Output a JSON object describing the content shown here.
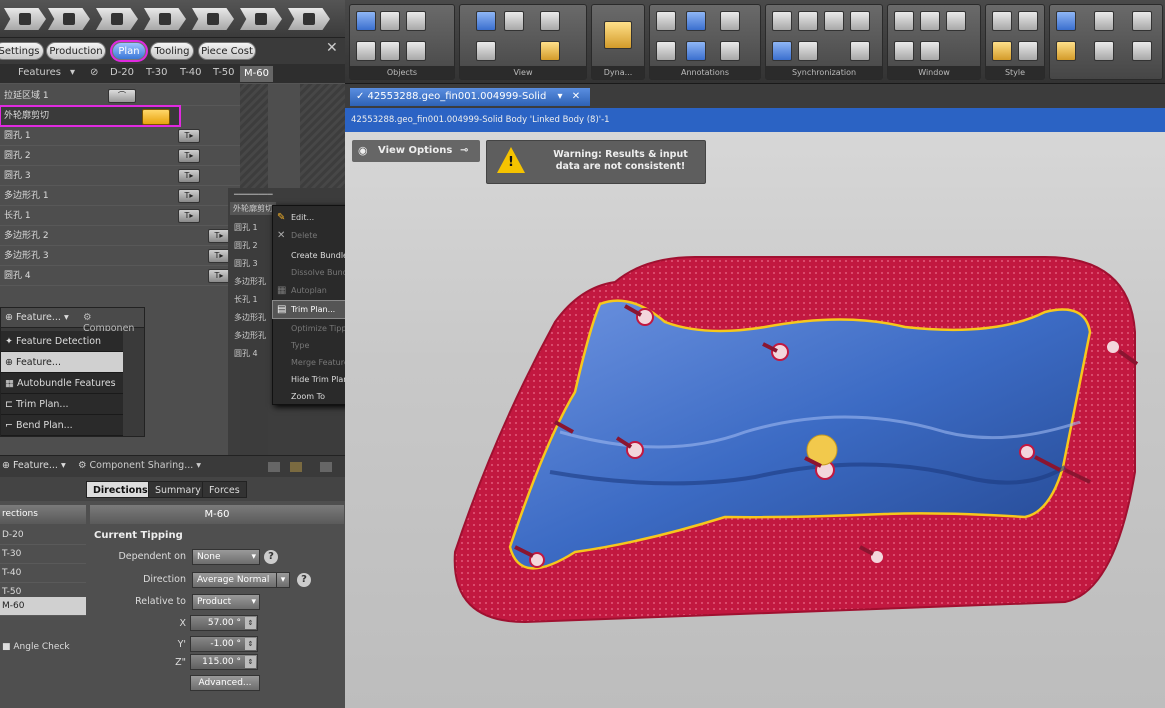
{
  "plan_tabs": [
    "Settings",
    "Production",
    "Plan",
    "Tooling",
    "Piece Cost"
  ],
  "features_header": {
    "label": "Features",
    "columns": [
      "D-20",
      "T-30",
      "T-40",
      "T-50",
      "M-60"
    ]
  },
  "feature_rows": [
    "拉延区域 1",
    "外轮廓剪切",
    "圆孔 1",
    "圆孔 2",
    "圆孔 3",
    "多边形孔 1",
    "长孔 1",
    "多边形孔 2",
    "多边形孔 3",
    "圆孔 4"
  ],
  "ghost_rows": [
    "外轮廓剪切",
    "圆孔 1",
    "圆孔 2",
    "圆孔 3",
    "多边形孔",
    "长孔 1",
    "多边形孔",
    "多边形孔",
    "圆孔 4"
  ],
  "context_menu": {
    "items": [
      {
        "label": "Edit...",
        "disabled": false,
        "submenu": false
      },
      {
        "label": "Delete",
        "disabled": true,
        "submenu": false
      },
      {
        "label": "Create Bundle",
        "disabled": false,
        "submenu": false
      },
      {
        "label": "Dissolve Bundle",
        "disabled": true,
        "submenu": false
      },
      {
        "label": "Autoplan",
        "disabled": true,
        "submenu": false
      },
      {
        "label": "Trim Plan...",
        "disabled": false,
        "submenu": false,
        "hover": true
      },
      {
        "label": "Optimize Tipping...",
        "disabled": true,
        "submenu": false
      },
      {
        "label": "Type",
        "disabled": true,
        "submenu": true
      },
      {
        "label": "Merge Features Into",
        "disabled": true,
        "submenu": true
      },
      {
        "label": "Hide Trim Plan",
        "disabled": false,
        "submenu": false
      },
      {
        "label": "Zoom To",
        "disabled": false,
        "submenu": false
      }
    ]
  },
  "feature_dropdown": {
    "button_label": "Feature...",
    "component_label": "Componen",
    "items": [
      "Feature Detection",
      "Feature...",
      "Autobundle Features",
      "Trim Plan...",
      "Bend Plan..."
    ]
  },
  "feature_bar2": {
    "feature_label": "Feature...",
    "component_label": "Component Sharing..."
  },
  "bottom_tabs": [
    "Directions",
    "Summary",
    "Forces"
  ],
  "directions": {
    "header": "rections",
    "items": [
      "D-20",
      "T-30",
      "T-40",
      "T-50",
      "M-60"
    ],
    "selected": "M-60",
    "angle_check": "Angle Check"
  },
  "properties": {
    "title": "M-60",
    "section": "Current Tipping",
    "dependent_on": {
      "label": "Dependent on",
      "value": "None"
    },
    "direction": {
      "label": "Direction",
      "value": "Average Normal"
    },
    "relative_to": {
      "label": "Relative to",
      "value": "Product"
    },
    "x": {
      "label": "X",
      "value": "57.00 °"
    },
    "y": {
      "label": "Y'",
      "value": "-1.00 °"
    },
    "z": {
      "label": "Z\"",
      "value": "115.00 °"
    },
    "advanced": "Advanced..."
  },
  "ribbon_groups": [
    "Objects",
    "View",
    "Dyna...",
    "Annotations",
    "Synchronization",
    "Window",
    "Style"
  ],
  "doc_tab": "✓ 42553288.geo_fin001.004999-Solid",
  "doc_bar": "42553288.geo_fin001.004999-Solid Body 'Linked Body (8)'-1",
  "view_options": "View Options",
  "warning": "Warning: Results & input data are not consistent!",
  "colors": {
    "accent_magenta": "#e02ae0",
    "part_blue": "#3c6bc4",
    "blank_red": "#c21840",
    "trim_yellow": "#f6c81c"
  }
}
